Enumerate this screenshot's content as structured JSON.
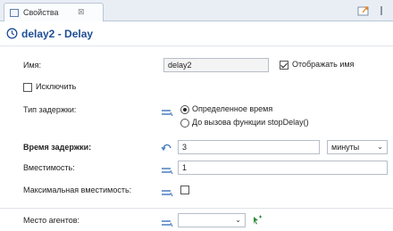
{
  "tab": {
    "label": "Свойства",
    "close": "⊠"
  },
  "header": {
    "title": "delay2 - Delay"
  },
  "fields": {
    "name_label": "Имя:",
    "name_value": "delay2",
    "show_name_label": "Отображать имя",
    "exclude_label": "Исключить",
    "delay_type_label": "Тип задержки:",
    "delay_type_options": [
      "Определенное время",
      "До вызова функции stopDelay()"
    ],
    "delay_time_label": "Время задержки:",
    "delay_time_value": "3",
    "delay_unit": "минуты",
    "capacity_label": "Вместимость:",
    "capacity_value": "1",
    "max_capacity_label": "Максимальная вместимость:",
    "agent_location_label": "Место агентов:"
  },
  "colors": {
    "title": "#1f4e96",
    "mode_icon": "#4a7fc1"
  }
}
